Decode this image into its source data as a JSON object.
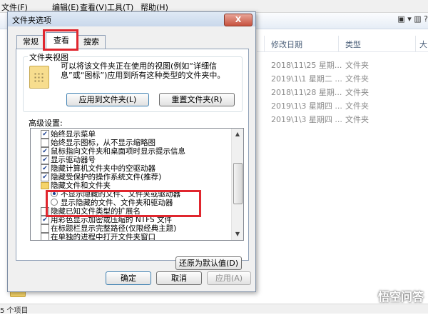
{
  "explorer": {
    "menu": [
      "文件(F)",
      "编辑(E)",
      "查看(V)",
      "工具(T)",
      "帮助(H)"
    ],
    "toolbar_right": "▣ ▾  ▥  ?",
    "columns": {
      "modified": "修改日期",
      "type": "类型",
      "size": "大"
    },
    "rows": [
      {
        "date": "2018\\11\\25 星期...",
        "type": "文件夹"
      },
      {
        "date": "2019\\1\\1 星期二 ...",
        "type": "文件夹"
      },
      {
        "date": "2018\\11\\28 星期...",
        "type": "文件夹"
      },
      {
        "date": "2019\\1\\3 星期四 ...",
        "type": "文件夹"
      },
      {
        "date": "2019\\1\\3 星期四 ...",
        "type": "文件夹"
      }
    ],
    "status": "5 个项目",
    "watermark": "悟空问答"
  },
  "dialog": {
    "title": "文件夹选项",
    "close": "X",
    "tabs": {
      "general": "常规",
      "view": "查看",
      "search": "搜索"
    },
    "folder_views": {
      "legend": "文件夹视图",
      "description": "可以将该文件夹正在使用的视图(例如“详细信息”或“图标”)应用到所有这种类型的文件夹中。",
      "apply_button": "应用到文件夹(L)",
      "reset_button": "重置文件夹(R)"
    },
    "advanced_label": "高级设置:",
    "advanced_items": [
      {
        "kind": "check",
        "checked": true,
        "label": "始终显示菜单"
      },
      {
        "kind": "check",
        "checked": false,
        "label": "始终显示图标，从不显示缩略图"
      },
      {
        "kind": "check",
        "checked": true,
        "label": "鼠标指向文件夹和桌面项时显示提示信息"
      },
      {
        "kind": "check",
        "checked": true,
        "label": "显示驱动器号"
      },
      {
        "kind": "check",
        "checked": true,
        "label": "隐藏计算机文件夹中的空驱动器"
      },
      {
        "kind": "check",
        "checked": true,
        "label": "隐藏受保护的操作系统文件(推荐)"
      },
      {
        "kind": "folder",
        "label": "隐藏文件和文件夹"
      },
      {
        "kind": "radio",
        "checked": true,
        "label": "不显示隐藏的文件、文件夹或驱动器"
      },
      {
        "kind": "radio",
        "checked": false,
        "label": "显示隐藏的文件、文件夹和驱动器"
      },
      {
        "kind": "check",
        "checked": false,
        "label": "隐藏已知文件类型的扩展名"
      },
      {
        "kind": "check",
        "checked": true,
        "label": "用彩色显示加密或压缩的 NTFS 文件"
      },
      {
        "kind": "check",
        "checked": false,
        "label": "在标题栏显示完整路径(仅限经典主题)"
      },
      {
        "kind": "check",
        "checked": false,
        "label": "在单独的进程中打开文件夹窗口"
      }
    ],
    "scroll_up": "▲",
    "scroll_down": "▼",
    "restore_defaults": "还原为默认值(D)",
    "ok": "确定",
    "cancel": "取消",
    "apply": "应用(A)"
  },
  "colors": {
    "highlight": "#e0262e",
    "check": "#1b3f91"
  }
}
